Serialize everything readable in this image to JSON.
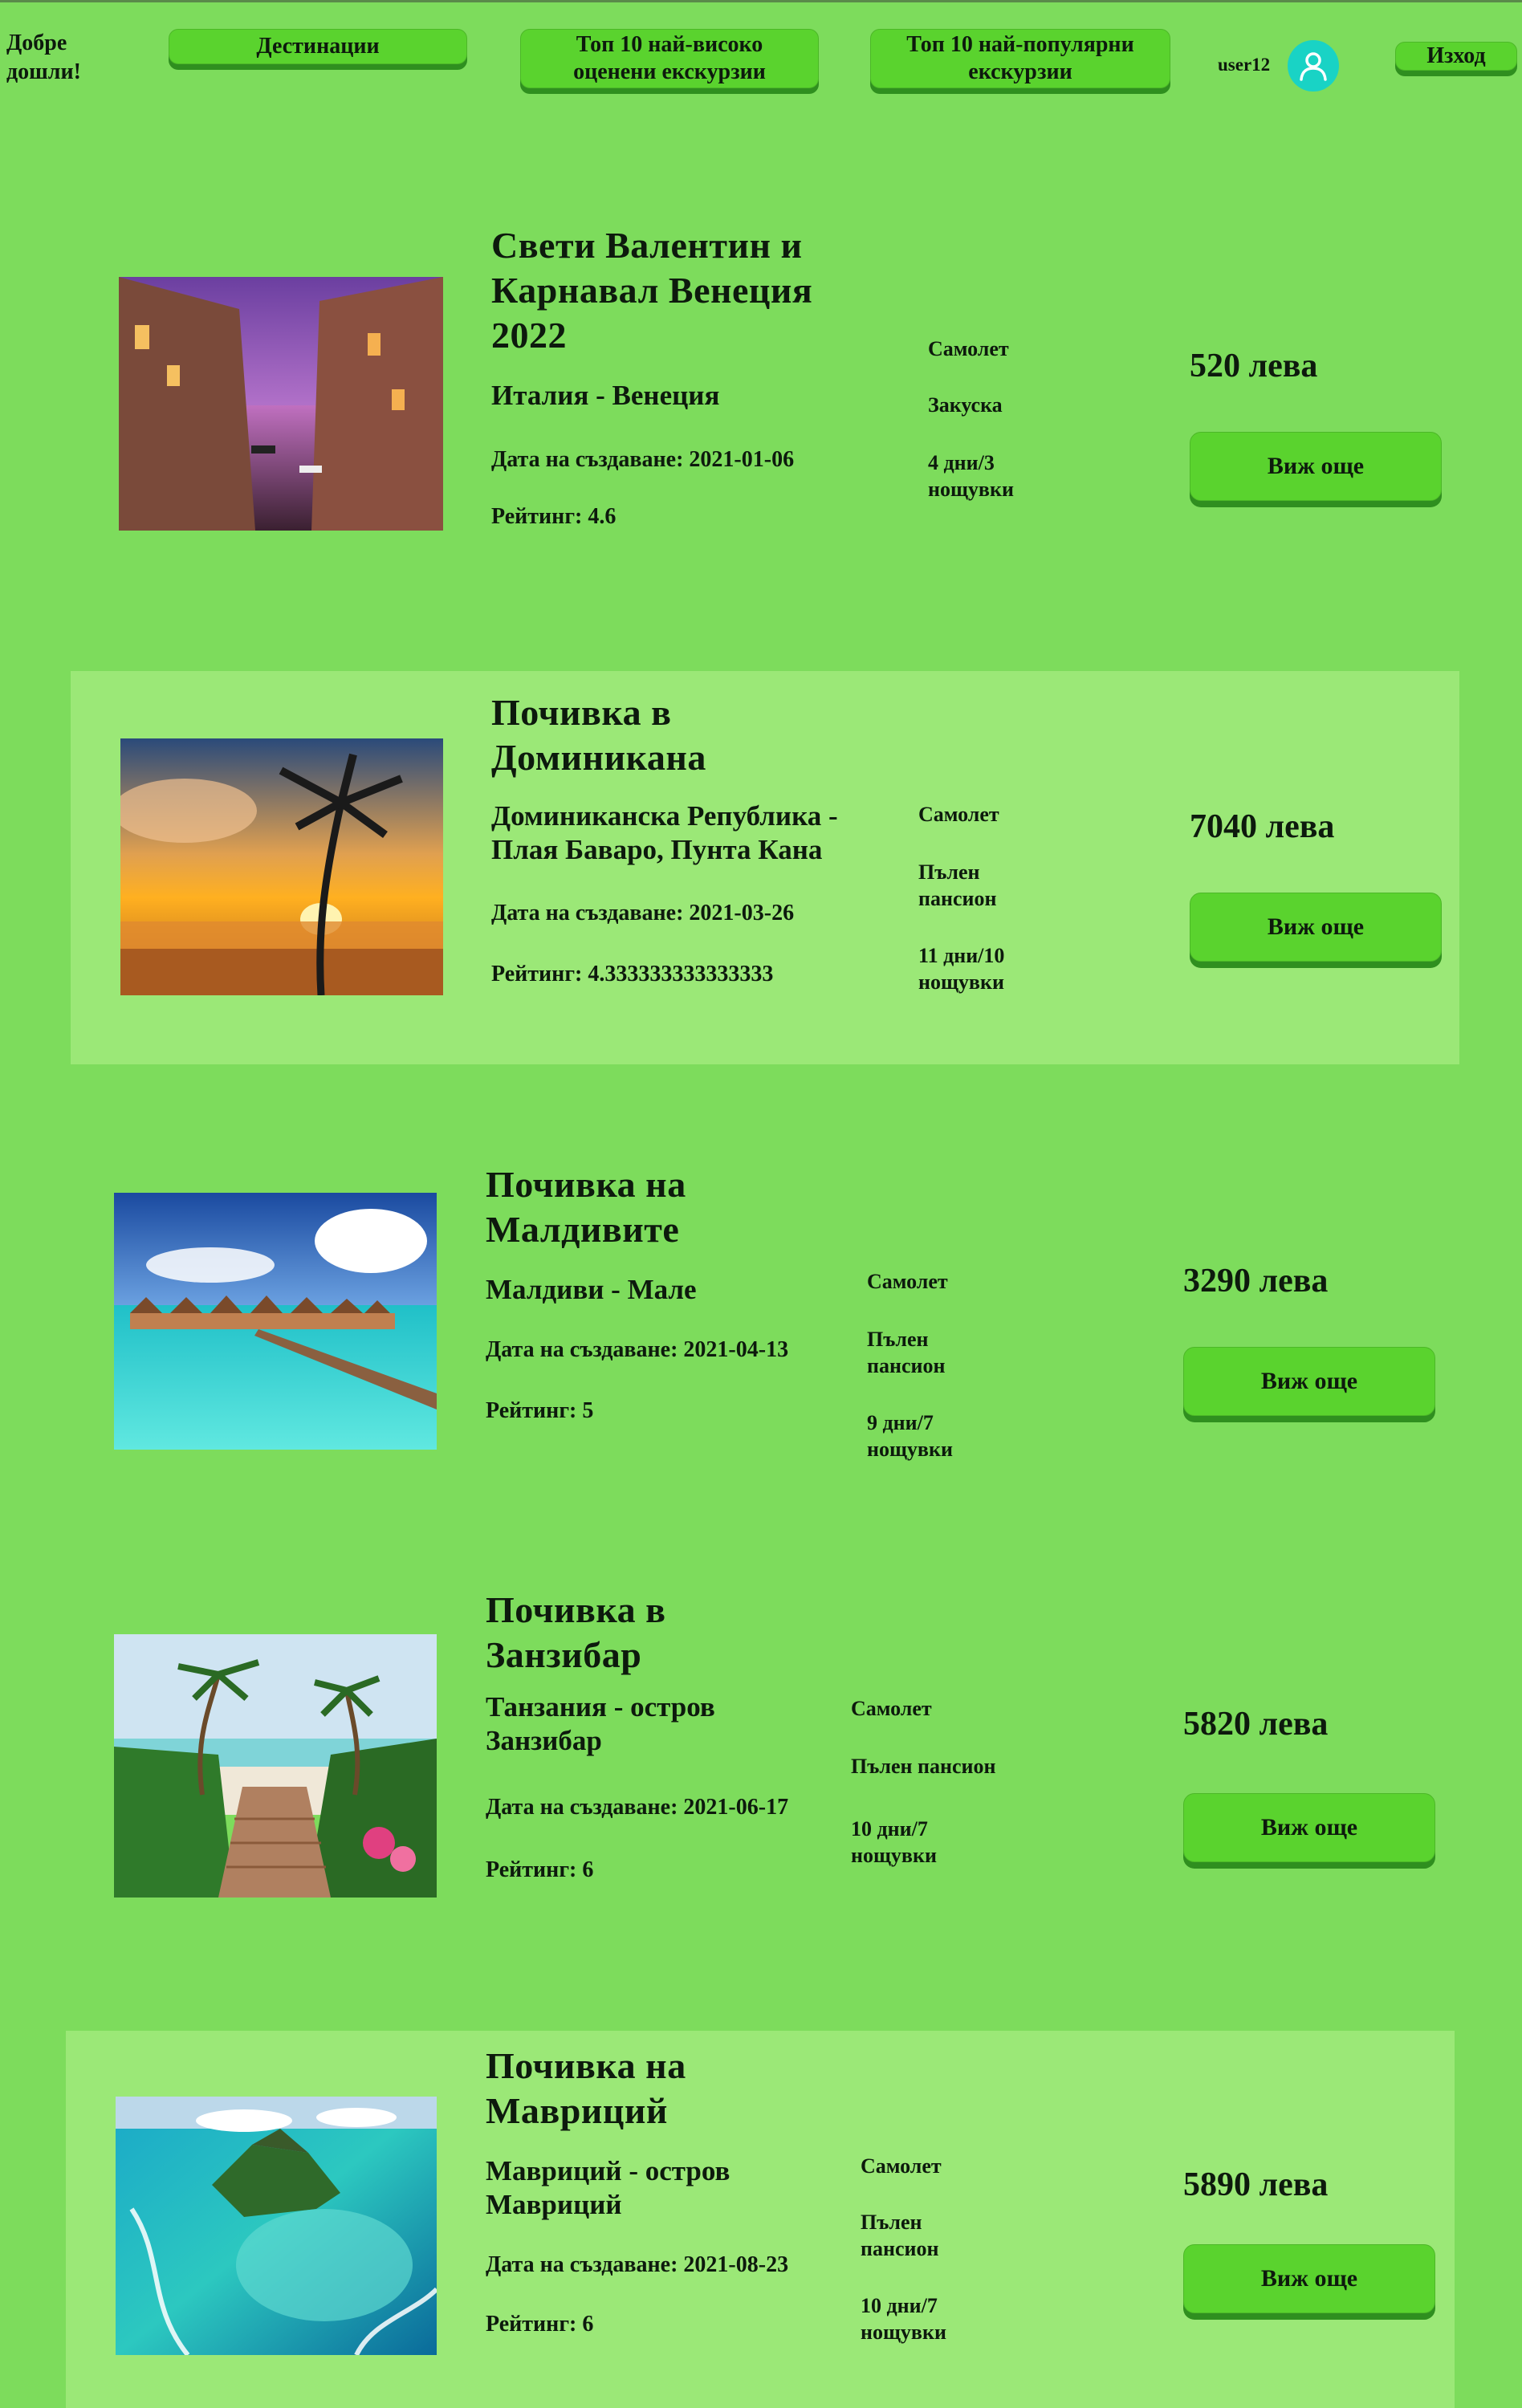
{
  "header": {
    "welcome": "Добре дошли!",
    "nav": {
      "destinations": "Дестинации",
      "top_rated": "Топ 10 най-високо оценени екскурзии",
      "top_popular": "Топ 10 най-популярни екскурзии",
      "logout": "Изход"
    },
    "username": "user12",
    "avatar_icon": "user-avatar-icon"
  },
  "colors": {
    "background": "#7ddc5c",
    "band": "#9be877",
    "button": "#5ad32e",
    "button_shadow": "#2f8f1f",
    "avatar": "#19d3c5"
  },
  "excursions": [
    {
      "title": "Свети Валентин и Карнавал Венеция 2022",
      "location": "Италия - Венеция",
      "created": "Дата на създаване: 2021-01-06",
      "rating": "Рейтинг: 4.6",
      "transport": "Самолет",
      "meals": "Закуска",
      "duration": "4 дни/3 нощувки",
      "price": "520 лева",
      "button": "Виж още",
      "image": "venice-canal-image"
    },
    {
      "title": "Почивка в Доминикана",
      "location": "Доминиканска Република - Плая Баваро, Пунта Кана",
      "created": "Дата на създаване: 2021-03-26",
      "rating": "Рейтинг: 4.333333333333333",
      "transport": "Самолет",
      "meals": "Пълен пансион",
      "duration": "11 дни/10 нощувки",
      "price": "7040 лева",
      "button": "Виж още",
      "image": "tropical-sunset-beach-image"
    },
    {
      "title": "Почивка на Малдивите",
      "location": "Малдиви - Мале",
      "created": "Дата на създаване: 2021-04-13",
      "rating": "Рейтинг: 5",
      "transport": "Самолет",
      "meals": "Пълен пансион",
      "duration": "9 дни/7 нощувки",
      "price": "3290 лева",
      "button": "Виж още",
      "image": "maldives-water-villas-image"
    },
    {
      "title": "Почивка в Занзибар",
      "location": "Танзания - остров Занзибар",
      "created": "Дата на създаване: 2021-06-17",
      "rating": "Рейтинг: 6",
      "transport": "Самолет",
      "meals": "Пълен пансион",
      "duration": "10 дни/7 нощувки",
      "price": "5820 лева",
      "button": "Виж още",
      "image": "zanzibar-beach-stairs-image"
    },
    {
      "title": "Почивка на Мавриций",
      "location": "Мавриций - остров Мавриций",
      "created": "Дата на създаване: 2021-08-23",
      "rating": "Рейтинг: 6",
      "transport": "Самолет",
      "meals": "Пълен пансион",
      "duration": "10 дни/7 нощувки",
      "price": "5890 лева",
      "button": "Виж още",
      "image": "mauritius-aerial-image"
    }
  ]
}
